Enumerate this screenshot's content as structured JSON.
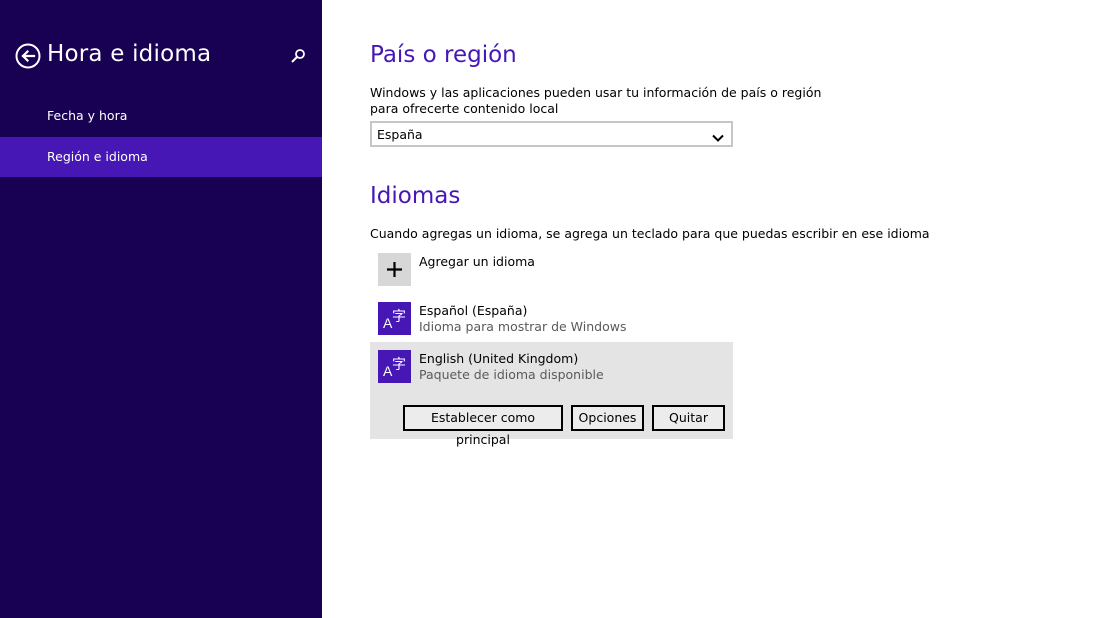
{
  "sidebar": {
    "title": "Hora e idioma",
    "back_icon": "back-arrow-icon",
    "search_icon": "search-icon",
    "items": [
      {
        "label": "Fecha y hora",
        "selected": false
      },
      {
        "label": "Región e idioma",
        "selected": true
      }
    ]
  },
  "region": {
    "title": "País o región",
    "description": "Windows y las aplicaciones pueden usar tu información de país o región para ofrecerte contenido local",
    "selected_country": "España",
    "chevron_icon": "chevron-down-icon"
  },
  "languages": {
    "title": "Idiomas",
    "description": "Cuando agregas un idioma, se agrega un teclado para que puedas escribir en ese idioma",
    "add_label": "Agregar un idioma",
    "add_icon": "plus-icon",
    "items": [
      {
        "name": "Español (España)",
        "status": "Idioma para mostrar de Windows",
        "icon": "language-icon"
      },
      {
        "name": "English (United Kingdom)",
        "status": "Paquete de idioma disponible",
        "icon": "language-icon",
        "selected": true
      }
    ],
    "actions": {
      "set_primary": "Establecer como principal",
      "options": "Opciones",
      "remove": "Quitar"
    }
  },
  "colors": {
    "sidebar_bg": "#180052",
    "sidebar_selected": "#4617b4",
    "accent": "#4617b4",
    "selected_row_bg": "#e4e4e4"
  }
}
